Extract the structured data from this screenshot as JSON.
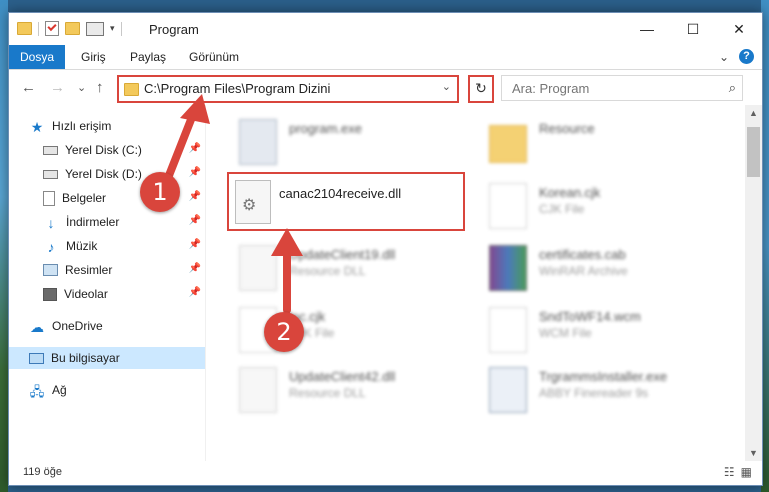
{
  "window": {
    "title": "Program"
  },
  "titlebar": {
    "minimize_glyph": "—",
    "maximize_glyph": "☐",
    "close_glyph": "✕"
  },
  "ribbon": {
    "tabs": [
      "Dosya",
      "Giriş",
      "Paylaş",
      "Görünüm"
    ],
    "expand_glyph": "⌄",
    "help_glyph": "?"
  },
  "address_bar": {
    "path": "C:\\Program Files\\Program Dizini",
    "dropdown_glyph": "⌄",
    "refresh_glyph": "↻"
  },
  "search": {
    "placeholder": "Ara: Program",
    "icon_glyph": "⌕"
  },
  "nav": {
    "back": "←",
    "forward": "→",
    "recent": "⌄",
    "up": "↑"
  },
  "sidebar": {
    "quick_access": "Hızlı erişim",
    "items": [
      {
        "label": "Yerel Disk (C:)",
        "icon": "drive-icon"
      },
      {
        "label": "Yerel Disk (D:)",
        "icon": "drive-icon"
      },
      {
        "label": "Belgeler",
        "icon": "documents-icon"
      },
      {
        "label": "İndirmeler",
        "icon": "downloads-icon"
      },
      {
        "label": "Müzik",
        "icon": "music-icon"
      },
      {
        "label": "Resimler",
        "icon": "pictures-icon"
      },
      {
        "label": "Videolar",
        "icon": "videos-icon"
      }
    ],
    "onedrive": "OneDrive",
    "this_pc": "Bu bilgisayar",
    "network": "Ağ"
  },
  "files": [
    {
      "name": "program.exe",
      "sub": ""
    },
    {
      "name": "Resource",
      "sub": ""
    },
    {
      "name": "canac2104receive.dll",
      "sub": ""
    },
    {
      "name": "Korean.cjk",
      "sub": "CJK File"
    },
    {
      "name": "UpdateClient19.dll",
      "sub": "Resource DLL"
    },
    {
      "name": "certificates.cab",
      "sub": "WinRAR Archive"
    },
    {
      "name": "loc.cjk",
      "sub": "CJK File"
    },
    {
      "name": "SndToWF14.wcm",
      "sub": "WCM File"
    },
    {
      "name": "UpdateClient42.dll",
      "sub": "Resource DLL"
    },
    {
      "name": "TrgrammsInstaller.exe",
      "sub": "ABBY Finereader 9s"
    }
  ],
  "status": {
    "item_count": "119 öğe"
  },
  "annotations": {
    "step1": "1",
    "step2": "2",
    "accent_color": "#d9453c"
  }
}
